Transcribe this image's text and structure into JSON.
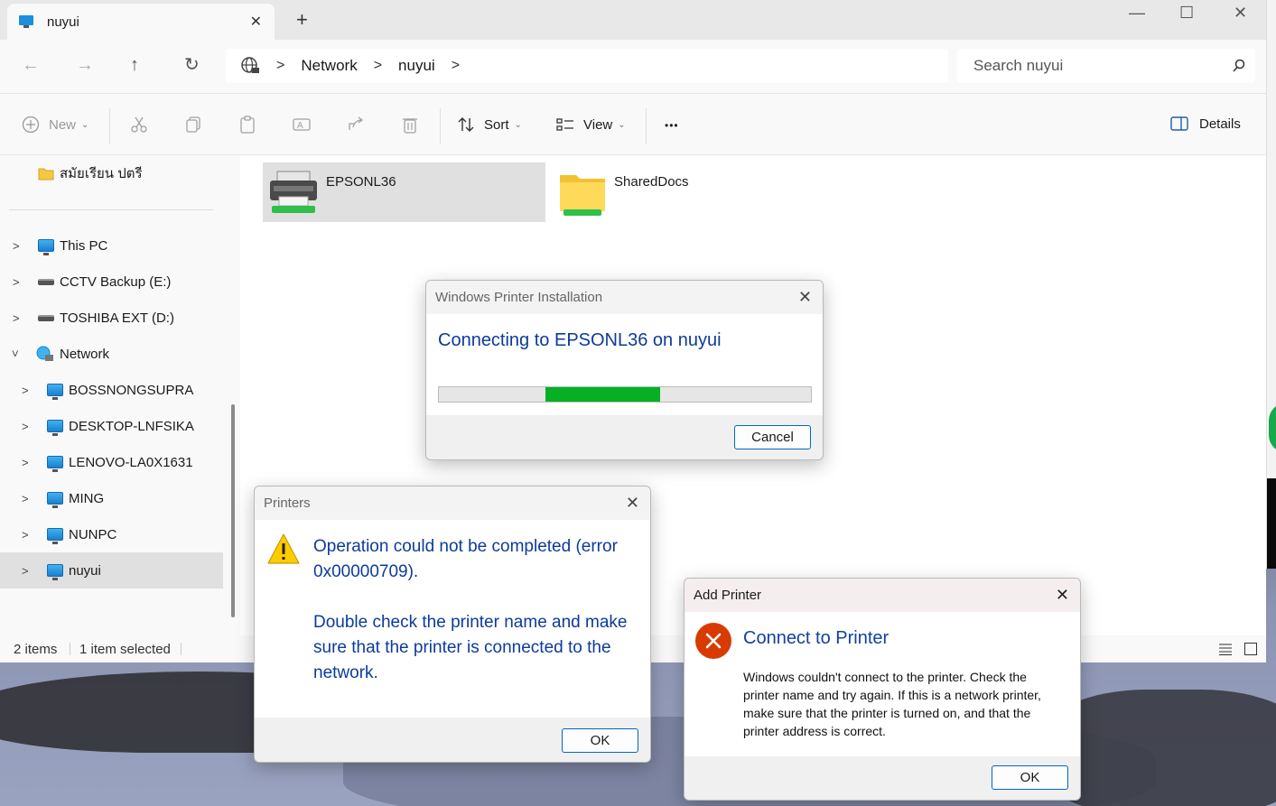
{
  "window": {
    "tab_title": "nuyui",
    "close_tab_glyph": "✕",
    "new_tab_glyph": "+",
    "minimize_glyph": "—",
    "maximize_glyph": "☐",
    "close_glyph": "✕"
  },
  "nav": {
    "back_glyph": "←",
    "forward_glyph": "→",
    "up_glyph": "↑",
    "refresh_glyph": "↻",
    "breadcrumb": [
      "Network",
      "nuyui"
    ],
    "sep_glyph": ">",
    "search_placeholder": "Search nuyui"
  },
  "toolbar": {
    "new_label": "New",
    "sort_label": "Sort",
    "view_label": "View",
    "more_glyph": "•••",
    "details_label": "Details"
  },
  "sidebar": {
    "pinned": {
      "label": "สมัยเรียน ปตรี"
    },
    "items": [
      {
        "label": "This PC"
      },
      {
        "label": "CCTV Backup (E:)"
      },
      {
        "label": "TOSHIBA EXT (D:)"
      },
      {
        "label": "Network"
      },
      {
        "label": "BOSSNONGSUPRA"
      },
      {
        "label": "DESKTOP-LNFSIKA"
      },
      {
        "label": "LENOVO-LA0X1631"
      },
      {
        "label": "MING"
      },
      {
        "label": "NUNPC"
      },
      {
        "label": "nuyui"
      }
    ]
  },
  "files": [
    {
      "name": "EPSONL36"
    },
    {
      "name": "SharedDocs"
    }
  ],
  "status": {
    "count": "2 items",
    "selected": "1 item selected"
  },
  "dialog_install": {
    "title": "Windows Printer Installation",
    "message": "Connecting to EPSONL36 on nuyui",
    "cancel_label": "Cancel",
    "progress_color": "#06b025"
  },
  "dialog_printers": {
    "title": "Printers",
    "line1": "Operation could not be completed (error",
    "line2": "0x00000709).",
    "line3": "Double check the printer name and make",
    "line4": "sure that the printer is connected to the",
    "line5": "network.",
    "ok_label": "OK",
    "warning_glyph": "!"
  },
  "dialog_add": {
    "title": "Add Printer",
    "heading": "Connect to Printer",
    "line1": "Windows couldn't connect to the printer. Check the",
    "line2": "printer name and try again. If this is a network printer,",
    "line3": "make sure that the printer is turned on, and that the",
    "line4": "printer address is correct.",
    "ok_label": "OK",
    "error_glyph": "✕"
  },
  "colors": {
    "accent": "#0067c0",
    "dialog_text": "#0c3b9a",
    "error_red": "#d83b01"
  }
}
